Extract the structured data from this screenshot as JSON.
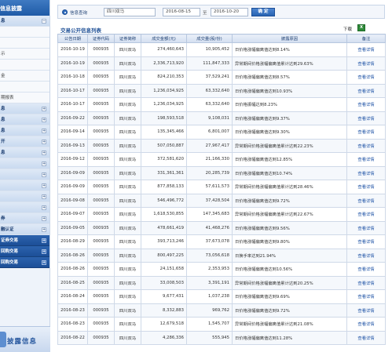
{
  "sidebar": {
    "header": "信息披露",
    "items": [
      {
        "label": "息",
        "style": "strong",
        "expand": "−"
      },
      {
        "label": "",
        "style": "plain",
        "expand": ""
      },
      {
        "label": "",
        "style": "plain",
        "expand": ""
      },
      {
        "label": "示",
        "style": "plain",
        "expand": ""
      },
      {
        "label": "",
        "style": "plain",
        "expand": ""
      },
      {
        "label": "金",
        "style": "plain",
        "expand": ""
      },
      {
        "label": "",
        "style": "plain",
        "expand": ""
      },
      {
        "label": "期报表",
        "style": "plain",
        "expand": ""
      },
      {
        "label": "息",
        "style": "strong",
        "expand": "+"
      },
      {
        "label": "息",
        "style": "strong",
        "expand": "+"
      },
      {
        "label": "息",
        "style": "strong",
        "expand": "+"
      },
      {
        "label": "开",
        "style": "strong",
        "expand": "+"
      },
      {
        "label": "息",
        "style": "strong",
        "expand": "+"
      },
      {
        "label": "",
        "style": "strong",
        "expand": "+"
      },
      {
        "label": "",
        "style": "strong",
        "expand": "+"
      },
      {
        "label": "",
        "style": "strong",
        "expand": "+"
      },
      {
        "label": "",
        "style": "strong",
        "expand": "+"
      },
      {
        "label": "",
        "style": "strong",
        "expand": "+"
      },
      {
        "label": "券",
        "style": "strong",
        "expand": "+"
      },
      {
        "label": "融认证",
        "style": "strong",
        "expand": "+"
      },
      {
        "label": "证券交易",
        "style": "dark",
        "expand": "+"
      },
      {
        "label": "回购交易",
        "style": "dark",
        "expand": "+"
      },
      {
        "label": "回购交易",
        "style": "dark",
        "expand": "+"
      }
    ],
    "footer_title": "披露信息"
  },
  "filter": {
    "radio_label": "信息查询",
    "stock_value": "四川双马",
    "date_from": "2016-08-15",
    "date_sep": "至",
    "date_to": "2016-10-20",
    "confirm_label": "确 定"
  },
  "section_title": "交易公开信息列表",
  "download_label": "下载",
  "xls_icon_text": "X",
  "table": {
    "headers": [
      "公告日期",
      "证券代码",
      "证券简称",
      "成交金额(元)",
      "成交量(股/份)",
      "披露原因",
      "备注"
    ],
    "rows": [
      [
        "2016-10-19",
        "000935",
        "四川双马",
        "274,460,643",
        "10,905,452",
        "日价格涨幅偏离值达到8.14%",
        "查看详情"
      ],
      [
        "2016-10-19",
        "000935",
        "四川双马",
        "2,336,713,920",
        "111,847,333",
        "异常期间价格涨幅偏离值累计达到29.63%",
        "查看详情"
      ],
      [
        "2016-10-18",
        "000935",
        "四川双马",
        "824,210,353",
        "37,529,241",
        "日价格涨幅偏离值达到8.57%",
        "查看详情"
      ],
      [
        "2016-10-17",
        "000935",
        "四川双马",
        "1,236,034,925",
        "63,332,640",
        "日价格涨幅偏离值达到10.93%",
        "查看详情"
      ],
      [
        "2016-10-17",
        "000935",
        "四川双马",
        "1,236,034,925",
        "63,332,640",
        "日价格振幅达到8.23%",
        "查看详情"
      ],
      [
        "2016-09-22",
        "000935",
        "四川双马",
        "198,593,518",
        "9,108,031",
        "日价格涨幅偏离值达到9.37%",
        "查看详情"
      ],
      [
        "2016-09-14",
        "000935",
        "四川双马",
        "135,345,466",
        "6,801,007",
        "日价格涨幅偏离值达到9.30%",
        "查看详情"
      ],
      [
        "2016-09-13",
        "000935",
        "四川双马",
        "507,050,887",
        "27,967,417",
        "异常期间价格涨幅偏离值累计达到22.23%",
        "查看详情"
      ],
      [
        "2016-09-12",
        "000935",
        "四川双马",
        "372,581,620",
        "21,166,330",
        "日价格涨幅偏离值达到12.85%",
        "查看详情"
      ],
      [
        "2016-09-09",
        "000935",
        "四川双马",
        "331,361,361",
        "20,285,739",
        "日价格涨幅偏离值达到10.74%",
        "查看详情"
      ],
      [
        "2016-09-09",
        "000935",
        "四川双马",
        "877,858,133",
        "57,611,573",
        "异常期间价格涨幅偏离值累计达到28.46%",
        "查看详情"
      ],
      [
        "2016-09-08",
        "000935",
        "四川双马",
        "546,496,772",
        "37,428,504",
        "日价格涨幅偏离值达到9.72%",
        "查看详情"
      ],
      [
        "2016-09-07",
        "000935",
        "四川双马",
        "1,618,530,855",
        "147,345,683",
        "异常期间价格涨幅偏离值累计达到22.67%",
        "查看详情"
      ],
      [
        "2016-09-05",
        "000935",
        "四川双马",
        "478,661,419",
        "41,468,276",
        "日价格涨幅偏离值达到9.56%",
        "查看详情"
      ],
      [
        "2016-08-29",
        "000935",
        "四川双马",
        "393,713,246",
        "37,673,078",
        "日价格涨幅偏离值达到9.80%",
        "查看详情"
      ],
      [
        "2016-08-26",
        "000935",
        "四川双马",
        "800,497,225",
        "73,056,618",
        "日换手率达到21.94%",
        "查看详情"
      ],
      [
        "2016-08-26",
        "000935",
        "四川双马",
        "24,151,658",
        "2,353,953",
        "日价格涨幅偏离值达到10.56%",
        "查看详情"
      ],
      [
        "2016-08-25",
        "000935",
        "四川双马",
        "33,008,503",
        "3,391,191",
        "异常期间价格涨幅偏离值累计达到20.25%",
        "查看详情"
      ],
      [
        "2016-08-24",
        "000935",
        "四川双马",
        "9,677,431",
        "1,037,238",
        "日价格涨幅偏离值达到9.69%",
        "查看详情"
      ],
      [
        "2016-08-23",
        "000935",
        "四川双马",
        "8,332,883",
        "969,762",
        "日价格涨幅偏离值达到9.72%",
        "查看详情"
      ],
      [
        "2016-08-23",
        "000935",
        "四川双马",
        "12,679,518",
        "1,545,707",
        "异常期间价格涨幅偏离值累计达到21.08%",
        "查看详情"
      ],
      [
        "2016-08-22",
        "000935",
        "四川双马",
        "4,286,336",
        "555,945",
        "日价格涨幅偏离值达到11.28%",
        "查看详情"
      ]
    ]
  },
  "colors": {
    "accent": "#1f5aa6",
    "link": "#1a4fa3",
    "dark_nav": "#2c63ae"
  }
}
